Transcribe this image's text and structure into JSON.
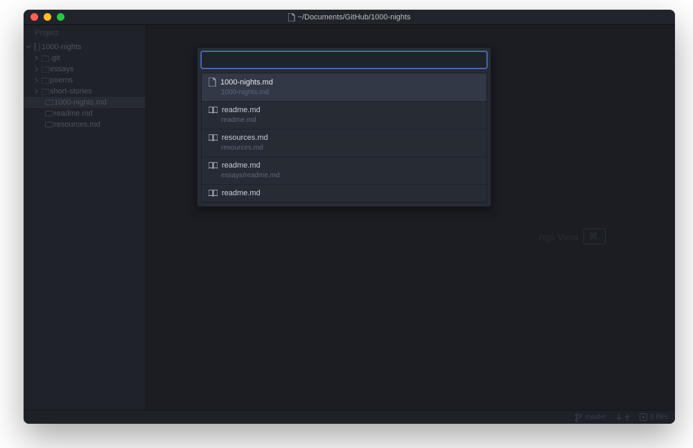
{
  "window": {
    "title": "~/Documents/GitHub/1000-nights"
  },
  "sidebar": {
    "panel_label": "Project",
    "root": {
      "name": "1000-nights"
    },
    "folders": [
      {
        "name": ".git"
      },
      {
        "name": "essays"
      },
      {
        "name": "poems"
      },
      {
        "name": "short-stories"
      }
    ],
    "files": [
      {
        "name": "1000-nights.md",
        "selected": true
      },
      {
        "name": "readme.md",
        "selected": false
      },
      {
        "name": "resources.md",
        "selected": false
      }
    ]
  },
  "fuzzy_finder": {
    "query": "",
    "items": [
      {
        "label": "1000-nights.md",
        "path": "1000-nights.md",
        "icon": "file",
        "selected": true
      },
      {
        "label": "readme.md",
        "path": "readme.md",
        "icon": "book",
        "selected": false
      },
      {
        "label": "resources.md",
        "path": "resources.md",
        "icon": "book",
        "selected": false
      },
      {
        "label": "readme.md",
        "path": "essays/readme.md",
        "icon": "book",
        "selected": false
      },
      {
        "label": "readme.md",
        "path": "",
        "icon": "book",
        "selected": false,
        "cut": true
      }
    ]
  },
  "background_hint": {
    "text": "ngs View",
    "key_glyph": "⌘,"
  },
  "status": {
    "branch": "master",
    "files_label": "0 files"
  }
}
